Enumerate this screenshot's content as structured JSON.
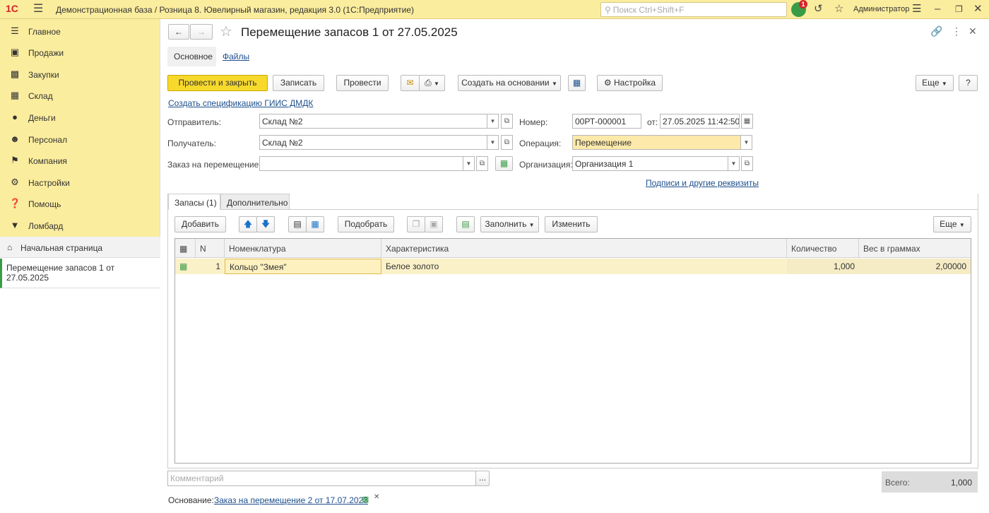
{
  "app": {
    "logo": "1С",
    "title": "Демонстрационная база / Розница 8. Ювелирный магазин, редакция 3.0  (1С:Предприятие)",
    "search_placeholder": "Поиск Ctrl+Shift+F",
    "notifications_count": "1",
    "user": "Администратор"
  },
  "sidebar": {
    "items": [
      {
        "label": "Главное",
        "icon": "menu-lines-icon"
      },
      {
        "label": "Продажи",
        "icon": "cart-icon"
      },
      {
        "label": "Закупки",
        "icon": "purchase-icon"
      },
      {
        "label": "Склад",
        "icon": "warehouse-icon"
      },
      {
        "label": "Деньги",
        "icon": "money-icon"
      },
      {
        "label": "Персонал",
        "icon": "person-icon"
      },
      {
        "label": "Компания",
        "icon": "flag-icon"
      },
      {
        "label": "Настройки",
        "icon": "gear-icon"
      },
      {
        "label": "Помощь",
        "icon": "help-icon"
      },
      {
        "label": "Ломбард",
        "icon": "pawnshop-icon"
      }
    ],
    "home": "Начальная страница",
    "open_doc": "Перемещение запасов 1 от 27.05.2025"
  },
  "doc": {
    "title": "Перемещение запасов 1 от 27.05.2025",
    "tabs": [
      "Основное",
      "Файлы"
    ],
    "toolbar": {
      "post_close": "Провести и закрыть",
      "save": "Записать",
      "post": "Провести",
      "create_based": "Создать на основании",
      "settings": "Настройка",
      "more": "Еще",
      "help": "?"
    },
    "spec_link": "Создать спецификацию ГИИС ДМДК",
    "fields": {
      "sender_label": "Отправитель:",
      "sender": "Склад №2",
      "receiver_label": "Получатель:",
      "receiver": "Склад №2",
      "order_label": "Заказ на перемещение:",
      "order": "",
      "number_label": "Номер:",
      "number": "00РТ-000001",
      "date_label": "от:",
      "date": "27.05.2025 11:42:50",
      "operation_label": "Операция:",
      "operation": "Перемещение",
      "org_label": "Организация:",
      "org": "Организация 1"
    },
    "signatures_link": "Подписи и другие реквизиты",
    "inner_tabs": [
      "Запасы (1)",
      "Дополнительно"
    ],
    "table_toolbar": {
      "add": "Добавить",
      "pick": "Подобрать",
      "fill": "Заполнить",
      "change": "Изменить",
      "more": "Еще"
    },
    "table": {
      "columns": [
        "N",
        "Номенклатура",
        "Характеристика",
        "Количество",
        "Вес в граммах"
      ],
      "rows": [
        {
          "n": "1",
          "item": "Кольцо \"Змея\"",
          "characteristic": "Белое золото",
          "qty": "1,000",
          "weight": "2,00000"
        }
      ]
    },
    "comment_placeholder": "Комментарий",
    "total_label": "Всего:",
    "total": "1,000",
    "basis_label": "Основание:",
    "basis_link": "Заказ на перемещение 2 от 17.07.2023"
  },
  "colors": {
    "top_bar": "#fbed9e",
    "primary_button": "#f7d92c",
    "link": "#1c4f8c",
    "selected_row": "#fbf1c8",
    "accent_green": "#3a9b47"
  }
}
